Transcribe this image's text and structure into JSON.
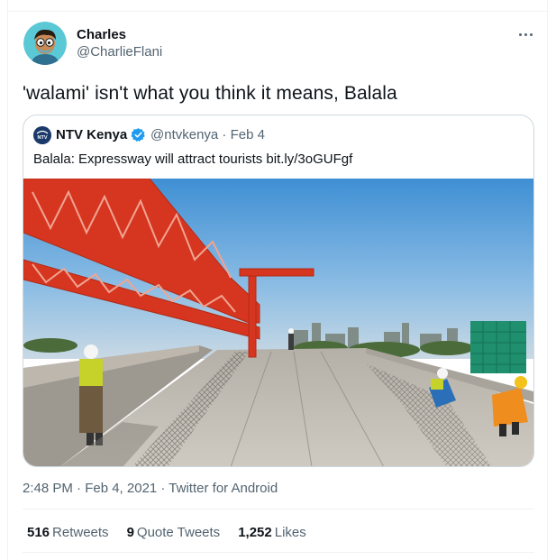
{
  "tweet": {
    "author": {
      "name": "Charles",
      "handle": "@CharlieFlani",
      "avatar_icon": "cartoon-avatar-icon"
    },
    "more_icon": "more-dots-icon",
    "text": "'walami' isn't what you think it means, Balala",
    "timestamp": "2:48 PM · Feb 4, 2021 · Twitter for Android",
    "stats": {
      "retweets_count": "516",
      "retweets_label": "Retweets",
      "quotes_count": "9",
      "quotes_label": "Quote Tweets",
      "likes_count": "1,252",
      "likes_label": "Likes"
    }
  },
  "quoted": {
    "name": "NTV Kenya",
    "verified_icon": "verified-badge-icon",
    "handle_date": "@ntvkenya · Feb 4",
    "text": "Balala: Expressway will attract tourists bit.ly/3oGUFgf",
    "avatar_text": "NTV",
    "image_desc": "construction-photo"
  },
  "colors": {
    "accent": "#1d9bf0",
    "text": "#0f1419",
    "muted": "#536471",
    "border": "#cfd9de"
  }
}
